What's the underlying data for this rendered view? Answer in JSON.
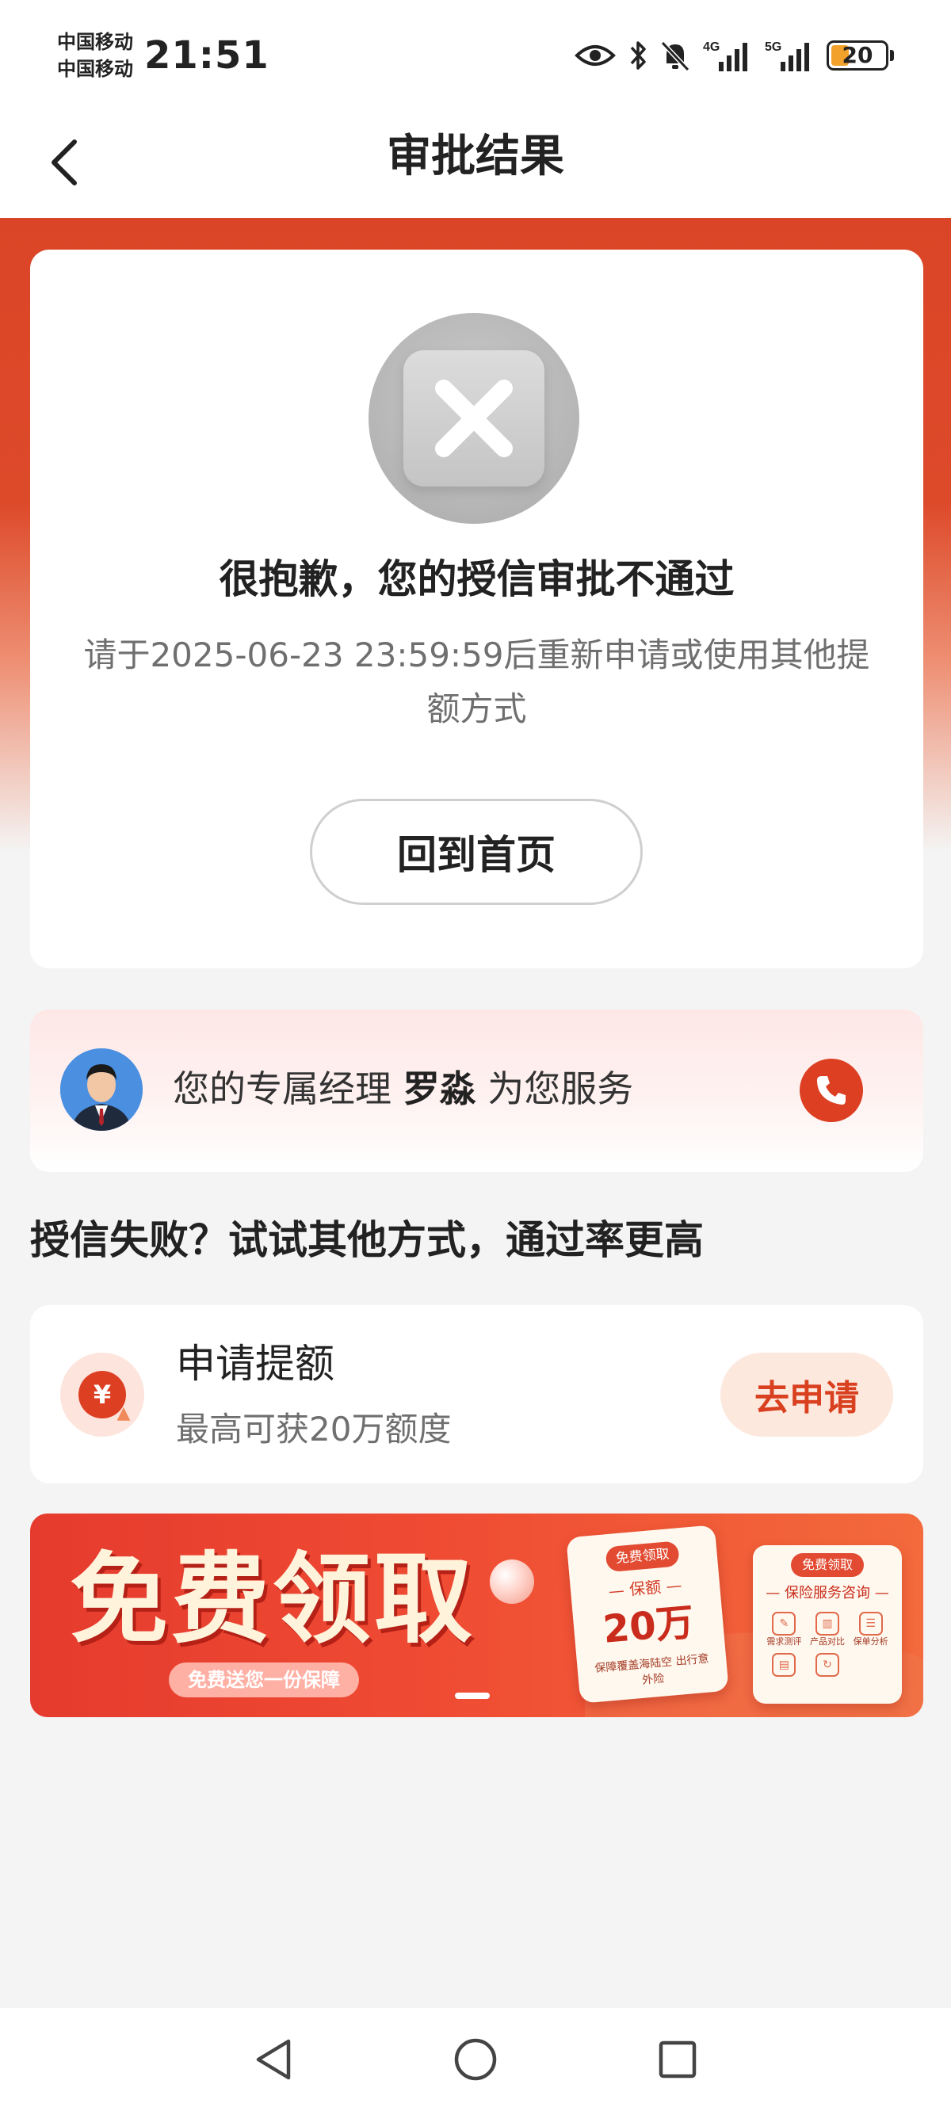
{
  "status_bar": {
    "carrier_1": "中国移动",
    "carrier_2": "中国移动",
    "time": "21:51",
    "network_1": "4G",
    "network_2": "5G",
    "battery": "20",
    "icons": [
      "eye-icon",
      "bluetooth-icon",
      "bell-muted-icon",
      "signal-4g-icon",
      "signal-5g-icon",
      "battery-icon"
    ]
  },
  "nav": {
    "title": "审批结果",
    "back_icon": "chevron-left-icon"
  },
  "result": {
    "icon": "reject-x-icon",
    "title": "很抱歉，您的授信审批不通过",
    "description": "请于2025-06-23 23:59:59后重新申请或使用其他提额方式",
    "home_button": "回到首页"
  },
  "manager": {
    "text_prefix": "您的专属经理 ",
    "name": "罗淼",
    "text_suffix": " 为您服务",
    "phone_icon": "phone-icon"
  },
  "alternatives": {
    "section_title": "授信失败？试试其他方式，通过率更高",
    "offer": {
      "icon": "yuan-coin-icon",
      "icon_symbol": "¥",
      "title": "申请提额",
      "subtitle": "最高可获20万额度",
      "button": "去申请"
    }
  },
  "banner": {
    "headline": "免费领取",
    "subline": "免费送您一份保障",
    "card1": {
      "tag": "免费领取",
      "label": "— 保额 —",
      "amount": "20万",
      "note": "保障覆盖海陆空 出行意外险"
    },
    "card2": {
      "tag": "免费领取",
      "title": "— 保险服务咨询 —",
      "items": [
        "需求测评",
        "产品对比",
        "保单分析"
      ]
    }
  },
  "colors": {
    "brand_red": "#dc3f22",
    "header_band": "#db4527",
    "apply_button_bg": "#fde8de",
    "apply_button_text": "#d9401f"
  }
}
